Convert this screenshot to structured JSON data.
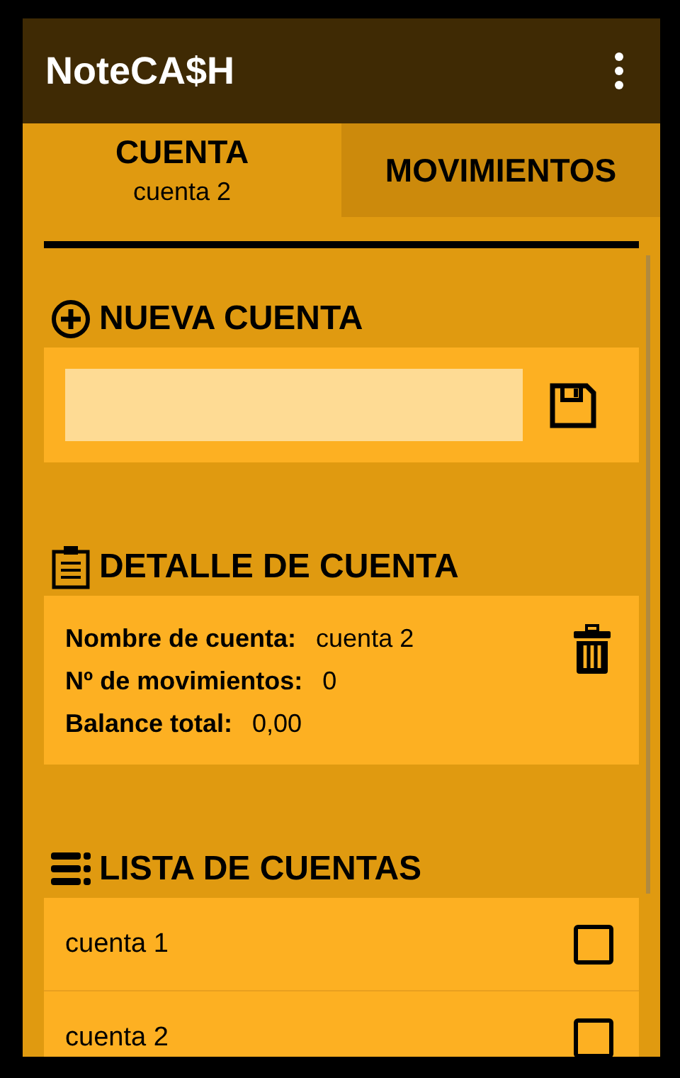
{
  "app_bar": {
    "title": "NoteCA$H"
  },
  "tabs": [
    {
      "label": "CUENTA",
      "subtitle": "cuenta 2",
      "selected": true
    },
    {
      "label": "MOVIMIENTOS",
      "selected": false
    }
  ],
  "new_account": {
    "heading": "NUEVA CUENTA"
  },
  "account_detail": {
    "heading": "DETALLE DE CUENTA",
    "fields": [
      {
        "label": "Nombre de cuenta:",
        "value": "cuenta 2"
      },
      {
        "label": "Nº de movimientos:",
        "value": "0"
      },
      {
        "label": "Balance total:",
        "value": "0,00"
      }
    ]
  },
  "account_list": {
    "heading": "LISTA DE CUENTAS",
    "items": [
      {
        "name": "cuenta 1",
        "checked": false
      },
      {
        "name": "cuenta 2",
        "checked": false
      }
    ]
  }
}
